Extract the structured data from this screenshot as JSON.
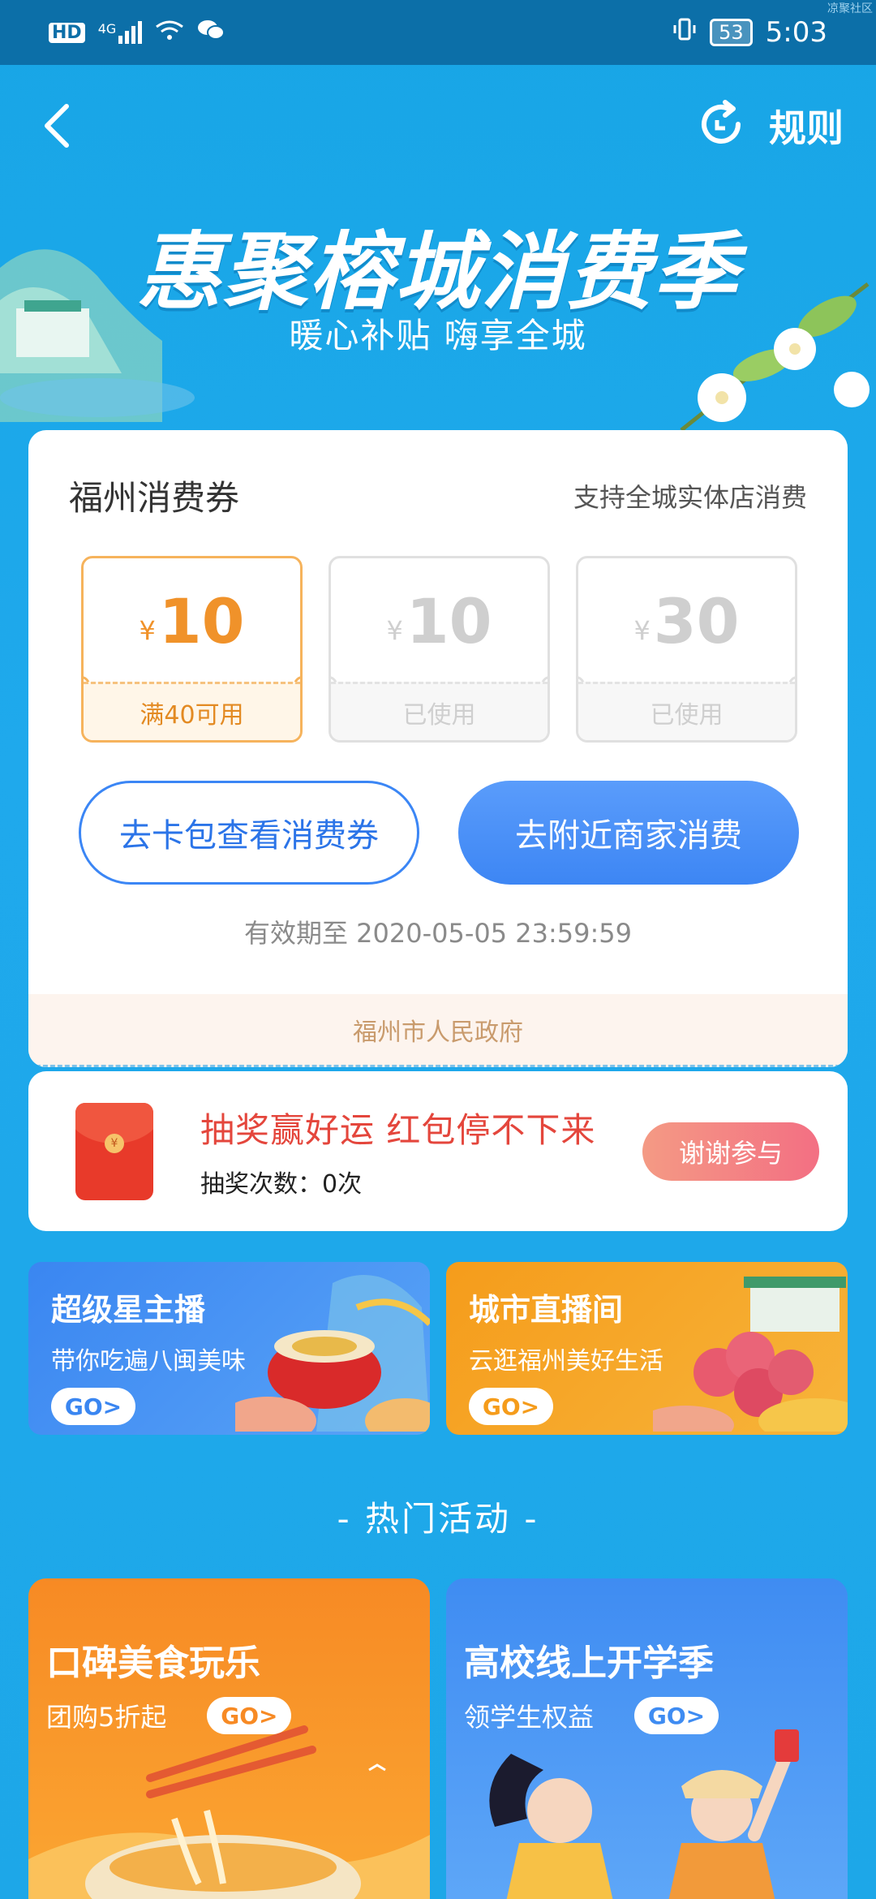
{
  "status_bar": {
    "left_icons": [
      "hd-icon",
      "signal-4g-icon",
      "wifi-icon",
      "wechat-icon"
    ],
    "hd_label": "HD",
    "network_label": "4G",
    "battery": "53",
    "time": "5:03",
    "watermark": "凉聚社区"
  },
  "nav": {
    "rules_label": "规则"
  },
  "hero": {
    "title": "惠聚榕城消费季",
    "subtitle": "暖心补贴 嗨享全城"
  },
  "coupon_card": {
    "title": "福州消费券",
    "support_text": "支持全城实体店消费",
    "vouchers": [
      {
        "currency": "¥",
        "amount": "10",
        "note": "满40可用",
        "state": "active"
      },
      {
        "currency": "¥",
        "amount": "10",
        "note": "已使用",
        "state": "used"
      },
      {
        "currency": "¥",
        "amount": "30",
        "note": "已使用",
        "state": "used"
      }
    ],
    "wallet_button": "去卡包查看消费券",
    "nearby_button": "去附近商家消费",
    "validity": "有效期至 2020-05-05 23:59:59",
    "issuer": "福州市人民政府"
  },
  "lottery": {
    "title": "抽奖赢好运 红包停不下来",
    "count": "抽奖次数：0次",
    "button": "谢谢参与"
  },
  "promos": [
    {
      "title": "超级星主播",
      "subtitle": "带你吃遍八闽美味",
      "go": "GO>"
    },
    {
      "title": "城市直播间",
      "subtitle": "云逛福州美好生活",
      "go": "GO>"
    }
  ],
  "section_title": "- 热门活动 -",
  "activities": [
    {
      "title": "口碑美食玩乐",
      "subtitle": "团购5折起",
      "go": "GO>"
    },
    {
      "title": "高校线上开学季",
      "subtitle": "领学生权益",
      "go": "GO>"
    }
  ],
  "colors": {
    "background": "#1da7e8",
    "primary_button": "#3d86f4",
    "voucher_active": "#f0922a",
    "lottery_red": "#e4463c"
  }
}
